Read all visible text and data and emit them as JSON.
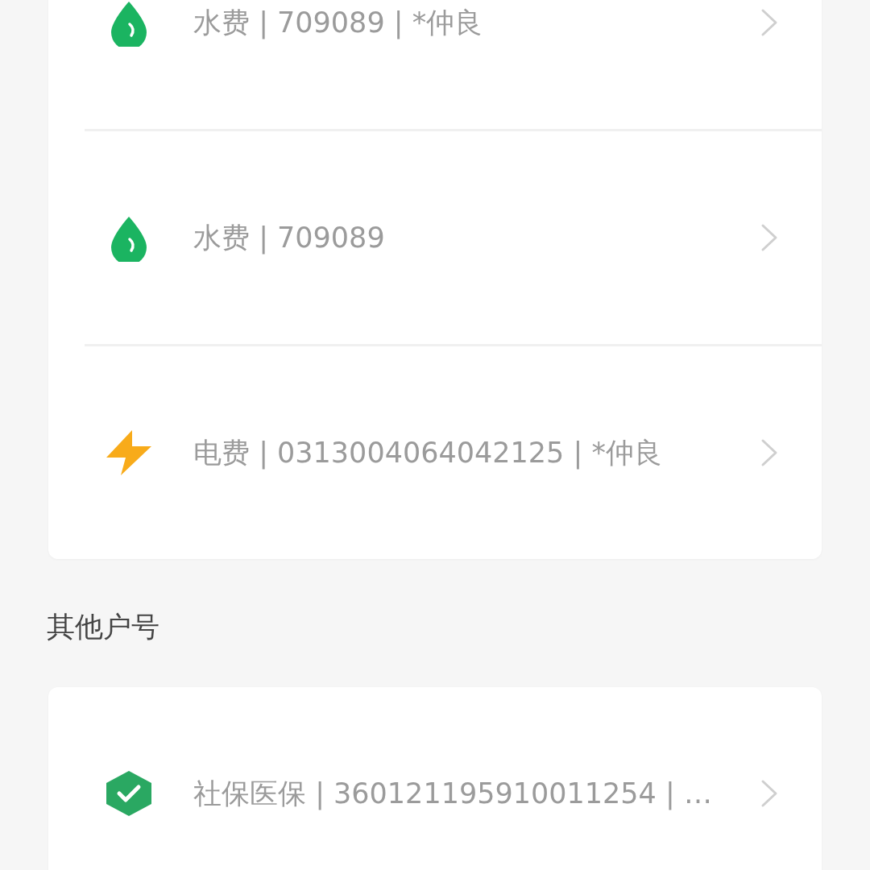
{
  "sections": [
    {
      "items": [
        {
          "kind": "water",
          "text": "水费 | 709089 | *仲良"
        },
        {
          "kind": "water",
          "text": "水费 | 709089"
        },
        {
          "kind": "electric",
          "text": "电费 | 0313004064042125 | *仲良"
        }
      ]
    },
    {
      "title": "其他户号",
      "items": [
        {
          "kind": "insurance",
          "text": "社保医保 | 360121195910011254 | …"
        }
      ]
    }
  ]
}
